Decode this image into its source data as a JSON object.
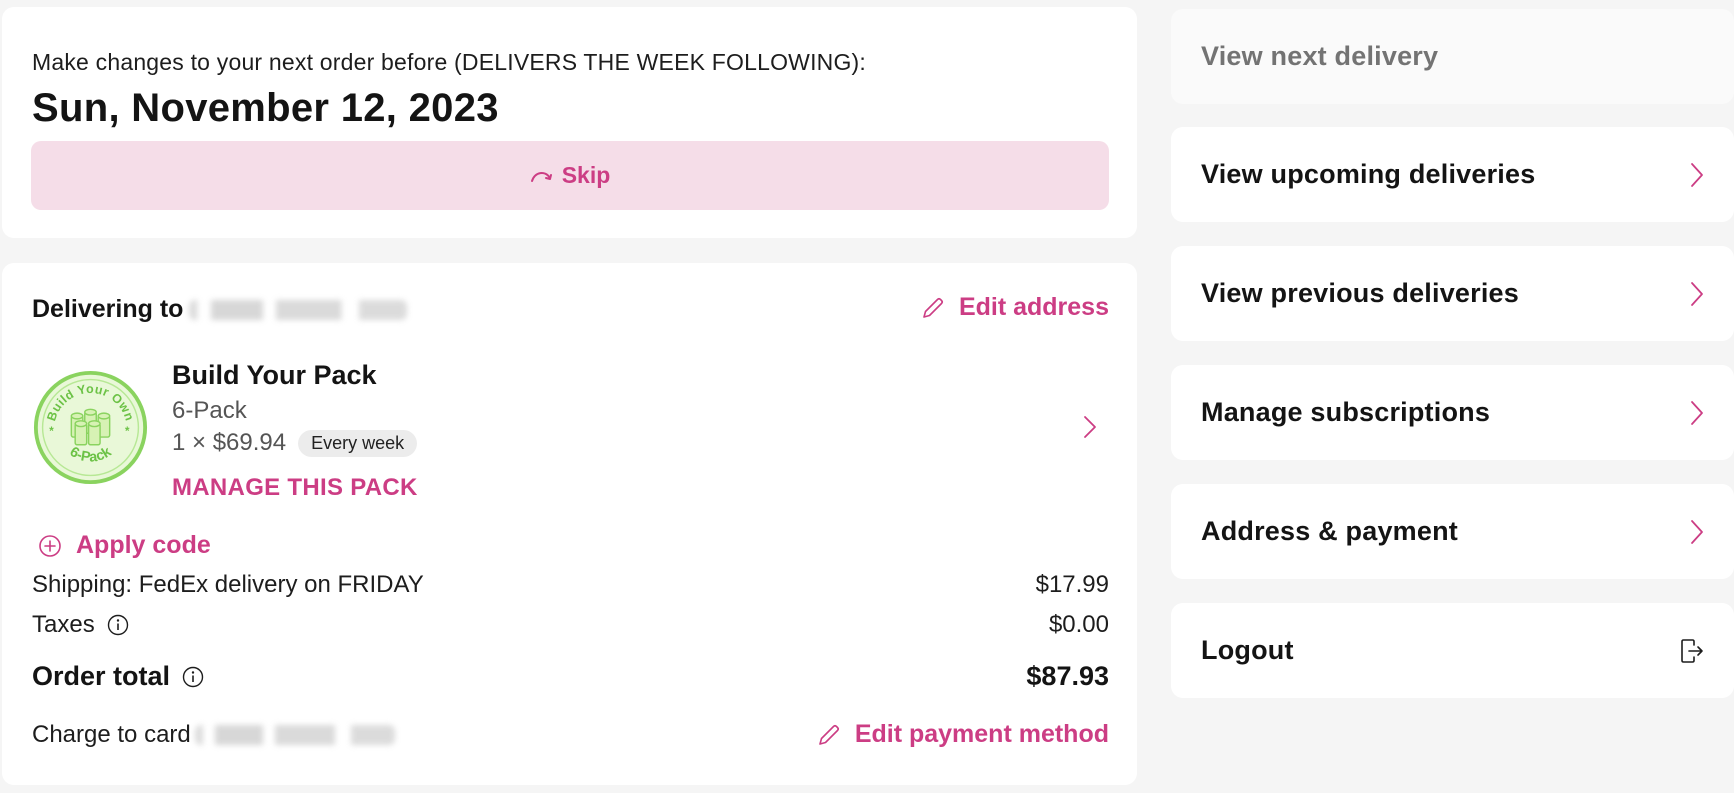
{
  "next_order": {
    "intro_text": "Make changes to your next order before (DELIVERS THE WEEK FOLLOWING):",
    "deadline_date": "Sun, November 12, 2023",
    "skip_label": "Skip",
    "skip_icon": "skip-arrow-icon"
  },
  "order": {
    "delivering_to_label": "Delivering to",
    "address_redacted": true,
    "edit_address_label": "Edit address",
    "edit_icon": "pencil-icon",
    "item": {
      "logo": "build-your-own-6-pack-logo",
      "logo_text_top": "Build Your Own",
      "logo_text_bottom": "6-Pack",
      "title": "Build Your Pack",
      "variant": "6-Pack",
      "price_line": "1 × $69.94",
      "frequency": "Every week",
      "manage_label": "MANAGE THIS PACK"
    },
    "apply_code_label": "Apply code",
    "apply_code_icon": "plus-circle-icon",
    "shipping_label": "Shipping: FedEx delivery on FRIDAY",
    "shipping_value": "$17.99",
    "taxes_label": "Taxes",
    "taxes_value": "$0.00",
    "total_label": "Order total",
    "total_value": "$87.93",
    "charge_label": "Charge to card",
    "card_redacted": true,
    "edit_payment_label": "Edit payment method"
  },
  "nav": {
    "items": [
      {
        "label": "View next delivery",
        "current": true,
        "icon": ""
      },
      {
        "label": "View upcoming deliveries",
        "current": false,
        "icon": "chevron-right-icon"
      },
      {
        "label": "View previous deliveries",
        "current": false,
        "icon": "chevron-right-icon"
      },
      {
        "label": "Manage subscriptions",
        "current": false,
        "icon": "chevron-right-icon"
      },
      {
        "label": "Address & payment",
        "current": false,
        "icon": "chevron-right-icon"
      },
      {
        "label": "Logout",
        "current": false,
        "icon": "logout-icon"
      }
    ]
  },
  "colors": {
    "accent": "#cc3d84",
    "accent_bg": "#f5dde8",
    "page_bg": "#f5f5f5",
    "card_bg": "#ffffff",
    "logo_green": "#7ed957"
  }
}
